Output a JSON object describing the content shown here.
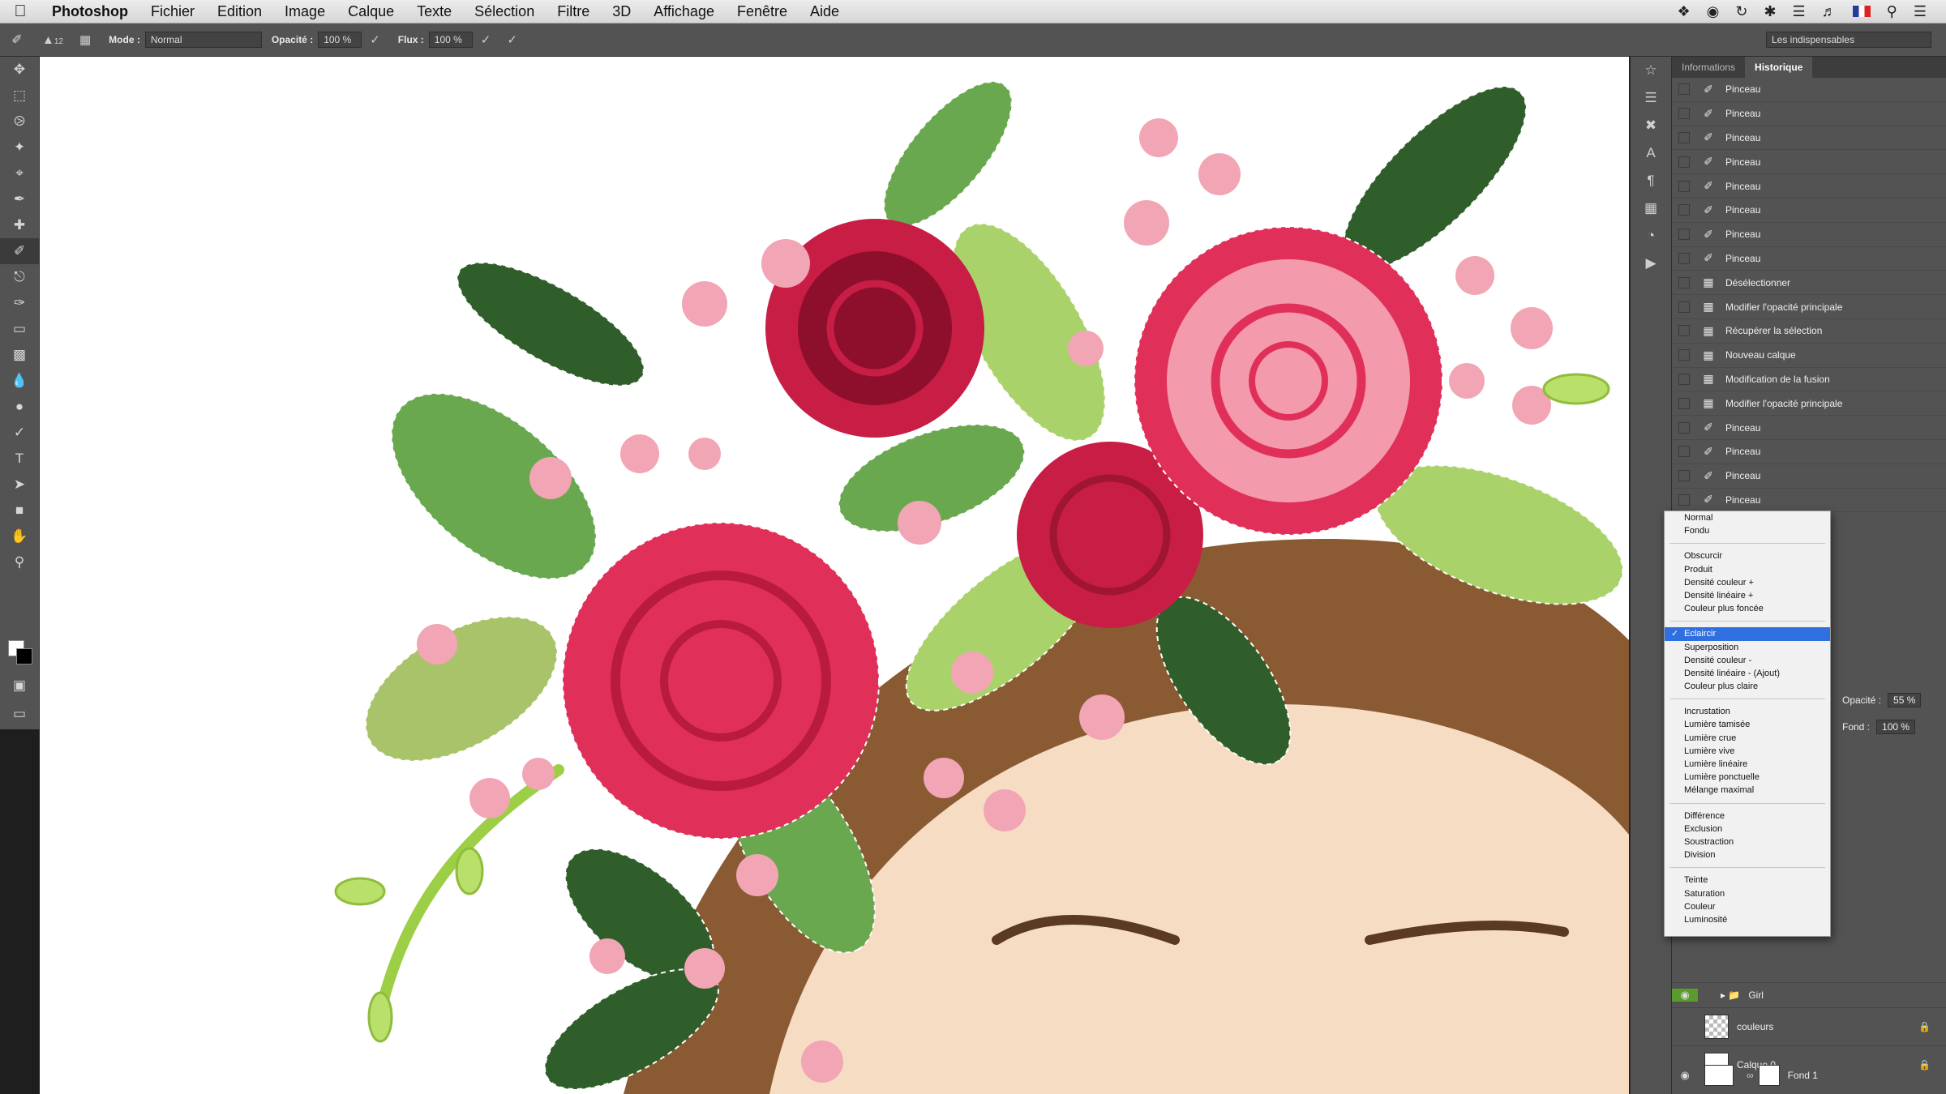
{
  "menubar": {
    "app_name": "Photoshop",
    "items": [
      "Fichier",
      "Edition",
      "Image",
      "Calque",
      "Texte",
      "Sélection",
      "Filtre",
      "3D",
      "Affichage",
      "Fenêtre",
      "Aide"
    ]
  },
  "options_bar": {
    "brush_size": "12",
    "mode_label": "Mode :",
    "mode_value": "Normal",
    "opacity_label": "Opacité :",
    "opacity_value": "100 %",
    "flow_label": "Flux :",
    "flow_value": "100 %",
    "workspace": "Les indispensables"
  },
  "panel": {
    "tabs": [
      "Informations",
      "Historique"
    ],
    "history": [
      {
        "label": "Pinceau",
        "icon": "brush-icon"
      },
      {
        "label": "Pinceau",
        "icon": "brush-icon"
      },
      {
        "label": "Pinceau",
        "icon": "brush-icon"
      },
      {
        "label": "Pinceau",
        "icon": "brush-icon"
      },
      {
        "label": "Pinceau",
        "icon": "brush-icon"
      },
      {
        "label": "Pinceau",
        "icon": "brush-icon"
      },
      {
        "label": "Pinceau",
        "icon": "brush-icon"
      },
      {
        "label": "Pinceau",
        "icon": "brush-icon"
      },
      {
        "label": "Désélectionner",
        "icon": "document-icon"
      },
      {
        "label": "Modifier l'opacité principale",
        "icon": "document-icon"
      },
      {
        "label": "Récupérer la sélection",
        "icon": "document-icon"
      },
      {
        "label": "Nouveau calque",
        "icon": "document-icon"
      },
      {
        "label": "Modification de la fusion",
        "icon": "document-icon"
      },
      {
        "label": "Modifier l'opacité principale",
        "icon": "document-icon"
      },
      {
        "label": "Pinceau",
        "icon": "brush-icon"
      },
      {
        "label": "Pinceau",
        "icon": "brush-icon"
      },
      {
        "label": "Pinceau",
        "icon": "brush-icon"
      },
      {
        "label": "Pinceau",
        "icon": "brush-icon"
      }
    ],
    "layers_opacity_label": "Opacité :",
    "layers_opacity_value": "55 %",
    "layers_fill_label": "Fond :",
    "layers_fill_value": "100 %",
    "layers": [
      {
        "name": "Girl",
        "type": "group"
      },
      {
        "name": "couleurs",
        "type": "layer"
      },
      {
        "name": "Calque 0",
        "type": "layer"
      },
      {
        "name": "Fond 1",
        "type": "layer"
      }
    ]
  },
  "blend_menu": {
    "groups": [
      [
        "Normal",
        "Fondu"
      ],
      [
        "Obscurcir",
        "Produit",
        "Densité couleur +",
        "Densité linéaire +",
        "Couleur plus foncée"
      ],
      [
        "Eclaircir",
        "Superposition",
        "Densité couleur -",
        "Densité linéaire - (Ajout)",
        "Couleur plus claire"
      ],
      [
        "Incrustation",
        "Lumière tamisée",
        "Lumière crue",
        "Lumière vive",
        "Lumière linéaire",
        "Lumière ponctuelle",
        "Mélange maximal"
      ],
      [
        "Différence",
        "Exclusion",
        "Soustraction",
        "Division"
      ],
      [
        "Teinte",
        "Saturation",
        "Couleur",
        "Luminosité"
      ]
    ],
    "selected": "Eclaircir"
  },
  "colors": {
    "rose_red": "#e0305a",
    "rose_dark": "#b81b3e",
    "rose_pink": "#f49aad",
    "leaf_green": "#6aa84f",
    "leaf_dark": "#2f5e2a",
    "leaf_light": "#a9d36a",
    "hair": "#8a5a33",
    "skin": "#f7dcc4"
  }
}
